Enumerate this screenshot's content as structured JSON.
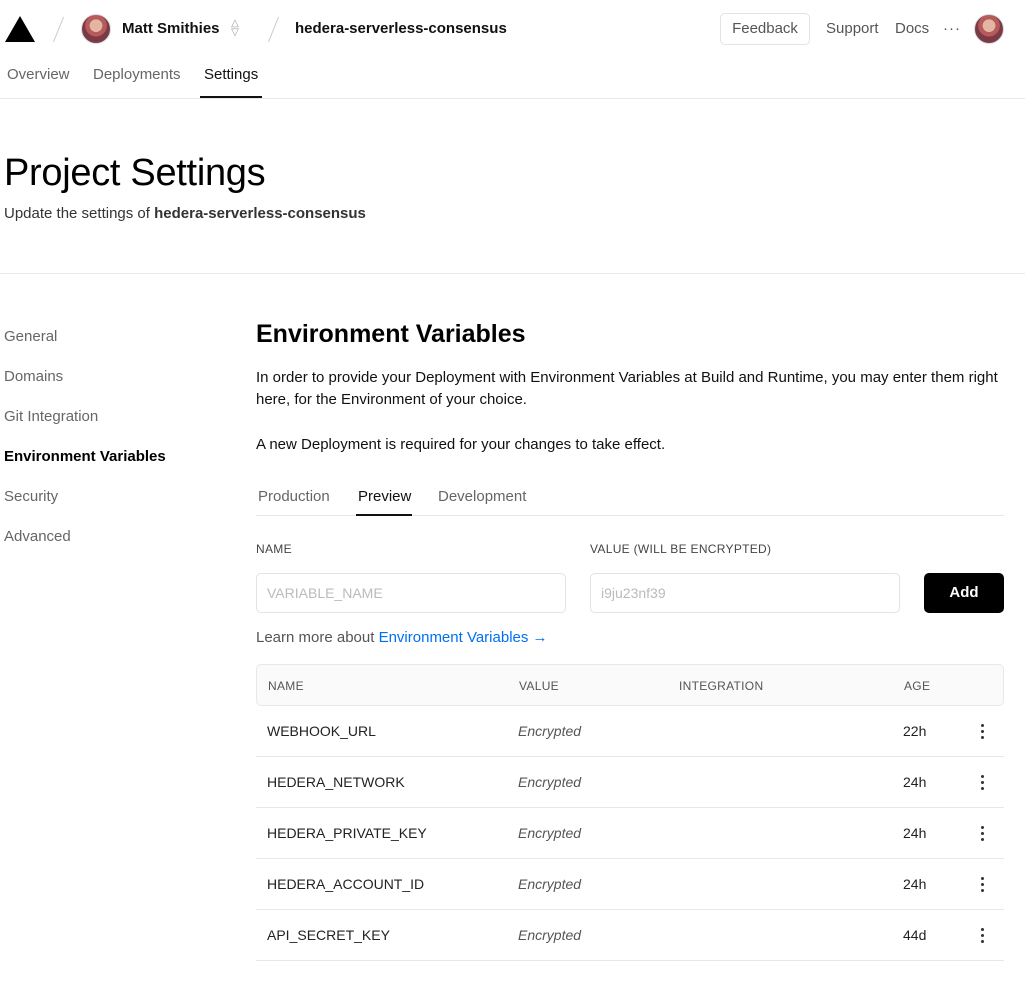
{
  "header": {
    "user_name": "Matt Smithies",
    "project_name": "hedera-serverless-consensus",
    "feedback_label": "Feedback",
    "support_label": "Support",
    "docs_label": "Docs",
    "more_label": "···"
  },
  "nav": {
    "tabs": [
      {
        "label": "Overview"
      },
      {
        "label": "Deployments"
      },
      {
        "label": "Settings"
      }
    ]
  },
  "page": {
    "title": "Project Settings",
    "subtitle_prefix": "Update the settings of ",
    "subtitle_project": "hedera-serverless-consensus"
  },
  "sidebar": {
    "items": [
      {
        "label": "General"
      },
      {
        "label": "Domains"
      },
      {
        "label": "Git Integration"
      },
      {
        "label": "Environment Variables"
      },
      {
        "label": "Security"
      },
      {
        "label": "Advanced"
      }
    ]
  },
  "env": {
    "title": "Environment Variables",
    "description": "In order to provide your Deployment with Environment Variables at Build and Runtime, you may enter them right here, for the Environment of your choice.",
    "notice": "A new Deployment is required for your changes to take effect.",
    "tabs": [
      {
        "label": "Production"
      },
      {
        "label": "Preview"
      },
      {
        "label": "Development"
      }
    ],
    "name_label": "NAME",
    "value_label": "VALUE (WILL BE ENCRYPTED)",
    "name_placeholder": "VARIABLE_NAME",
    "value_placeholder": "i9ju23nf39",
    "add_label": "Add",
    "learn_prefix": "Learn more about ",
    "learn_link": "Environment Variables →"
  },
  "table": {
    "columns": [
      "NAME",
      "VALUE",
      "INTEGRATION",
      "AGE"
    ],
    "rows": [
      {
        "name": "WEBHOOK_URL",
        "value": "Encrypted",
        "integration": "",
        "age": "22h"
      },
      {
        "name": "HEDERA_NETWORK",
        "value": "Encrypted",
        "integration": "",
        "age": "24h"
      },
      {
        "name": "HEDERA_PRIVATE_KEY",
        "value": "Encrypted",
        "integration": "",
        "age": "24h"
      },
      {
        "name": "HEDERA_ACCOUNT_ID",
        "value": "Encrypted",
        "integration": "",
        "age": "24h"
      },
      {
        "name": "API_SECRET_KEY",
        "value": "Encrypted",
        "integration": "",
        "age": "44d"
      }
    ]
  },
  "colors": {
    "accent": "#0070f3",
    "primary_button": "#000000"
  }
}
